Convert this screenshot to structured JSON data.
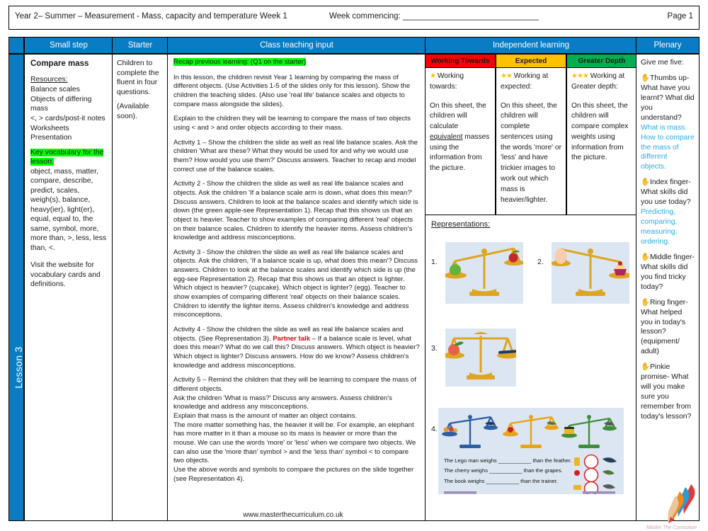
{
  "header": {
    "left": "Year 2– Summer – Measurement - Mass, capacity and temperature  Week 1",
    "middle": "Week commencing: ______________________________",
    "right": "Page 1"
  },
  "column_headers": {
    "small_step": "Small step",
    "starter": "Starter",
    "class_teaching_input": "Class teaching input",
    "independent_learning": "Independent learning",
    "plenary": "Plenary"
  },
  "spine": {
    "label": "Lesson 3"
  },
  "small_step": {
    "title": "Compare mass",
    "resources_label": "Resources:",
    "resources": "Balance scales\nObjects of differing mass\n<, > cards/post-it notes\nWorksheets\nPresentation",
    "key_vocab_label": "Key vocabulary for the lesson:",
    "key_vocab": "object, mass, matter, compare, describe, predict, scales, weigh(s), balance, heavy(ier), light(er), equal, equal to, the same, symbol, more, more than, >, less, less than, <.",
    "website_note": "Visit the website for vocabulary cards and definitions."
  },
  "starter": {
    "line1": "Children to complete the fluent in four questions.",
    "line2": "(Available soon)."
  },
  "class_teaching_input": {
    "recap_heading": "Recap previous learning: (Q1 on the starter)",
    "para1": "In this lesson, the children revisit Year 1 learning by comparing the mass of different objects. (Use Activities 1-5 of the slides only for this lesson). Show the children the teaching slides. (Also use 'real life' balance scales and objects to compare mass alongside the slides).",
    "para2": "Explain to the children they will be learning to compare the mass of two objects using < and > and order objects according to their mass.",
    "activity1": "Activity 1 – Show the children the slide as well as real life balance scales. Ask the children 'What are these? What they would be used for and why we would use them? How would you use them?' Discuss answers. Teacher to recap and model correct use of the balance scales.",
    "activity2": "Activity 2 - Show the children the slide as well as real life balance scales and objects. Ask the children 'If a balance scale arm is down, what does this mean?' Discuss answers. Children to look at the balance scales and identify which side is down (the green apple-see Representation 1). Recap that this shows us that an object is heavier. Teacher to show examples of comparing different 'real' objects on their balance scales. Children to identify the heavier items. Assess children's knowledge and address misconceptions.",
    "activity3": "Activity 3 - Show the children the slide as well as real life balance scales and objects. Ask the children, 'If a balance scale is up, what does this mean'? Discuss answers. Children to look at the balance scales and identify which side is up (the egg-see Representation 2). Recap that this shows us that an object is lighter. Which object is heavier? (cupcake). Which object is lighter? (egg). Teacher to show examples of comparing different 'real' objects on their balance scales. Children to identify the lighter items. Assess children's knowledge and address misconceptions.",
    "activity4_pre": "Activity 4 - Show the children the slide as well as real life balance scales and objects. (See Representation 3). ",
    "activity4_highlight": "Partner talk",
    "activity4_post": " – If a balance scale is level, what does this mean? What do we call this? Discuss answers. Which object is heavier? Which object is lighter? Discuss answers. How do we know? Assess children's knowledge and address misconceptions.",
    "activity5": "Activity 5 – Remind the children that they will be learning to compare the mass of different objects.\nAsk the children 'What is mass?' Discuss any answers. Assess children's knowledge and address any misconceptions.\nExplain that mass is the amount of matter an object contains.\nThe more matter something has, the heavier it will be. For example, an elephant has more matter in it than a mouse so its mass is heavier or more than the mouse. We can use the words 'more' or 'less' when we compare two objects. We can also use the 'more than' symbol > and the 'less than' symbol < to compare two objects.\nUse the above words and symbols to compare the pictures on the slide together (see Representation 4).",
    "website": "www.masterthecurriculum.co.uk"
  },
  "independent_learning": {
    "bands": [
      {
        "label": "Working Towards",
        "color": "#ff0000"
      },
      {
        "label": "Expected",
        "color": "#ffc000"
      },
      {
        "label": "Greater Depth",
        "color": "#00b050"
      }
    ],
    "columns": [
      {
        "stars": "★",
        "heading": "Working towards:",
        "body_pre": "On this sheet, the children will calculate ",
        "body_underline": "equivalent",
        "body_post": " masses using the information from the picture."
      },
      {
        "stars": "★★",
        "heading": "Working at expected:",
        "body_pre": "On this sheet, the children will complete sentences using the words 'more' or 'less' and have trickier images to work out which mass is heavier/lighter.",
        "body_underline": "",
        "body_post": ""
      },
      {
        "stars": "★★★",
        "heading": "Working at Greater depth:",
        "body_pre": "On this sheet, the children will compare complex weights using information from the picture.",
        "body_underline": "",
        "body_post": ""
      }
    ],
    "representations_title": "Representations:",
    "representations": [
      {
        "num": "1."
      },
      {
        "num": "2."
      },
      {
        "num": "3."
      },
      {
        "num": "4."
      }
    ],
    "worksheet": {
      "line1_pre": "The Lego man weighs",
      "line1_blank": "___________",
      "line1_post": "than the feather.",
      "line2_pre": "The cherry weighs",
      "line2_blank": "___________",
      "line2_post": "than the grapes.",
      "line3_pre": "The book weighs",
      "line3_blank": "___________",
      "line3_post": "than the trainer."
    }
  },
  "plenary": {
    "give_me_five": "Give me five:",
    "thumbs_label": "Thumbs up-",
    "thumbs_q": "What have you learnt? What did you understand?",
    "thumbs_a": "What is mass. How to compare the mass of different objects.",
    "index_label": "Index finger-",
    "index_q": "What skills did you use today?",
    "index_a": "Predicting, comparing, measuring, ordering.",
    "middle_label": "Middle finger-",
    "middle_q": "What skills did you find tricky today?",
    "ring_label": "Ring finger-",
    "ring_q": "What helped you in today's lesson? (equipment/ adult)",
    "pinkie_label": "Pinkie promise-",
    "pinkie_q": " What will you make sure you remember from today's lesson?"
  },
  "branding": {
    "logo_text": "Master The Curriculum"
  }
}
